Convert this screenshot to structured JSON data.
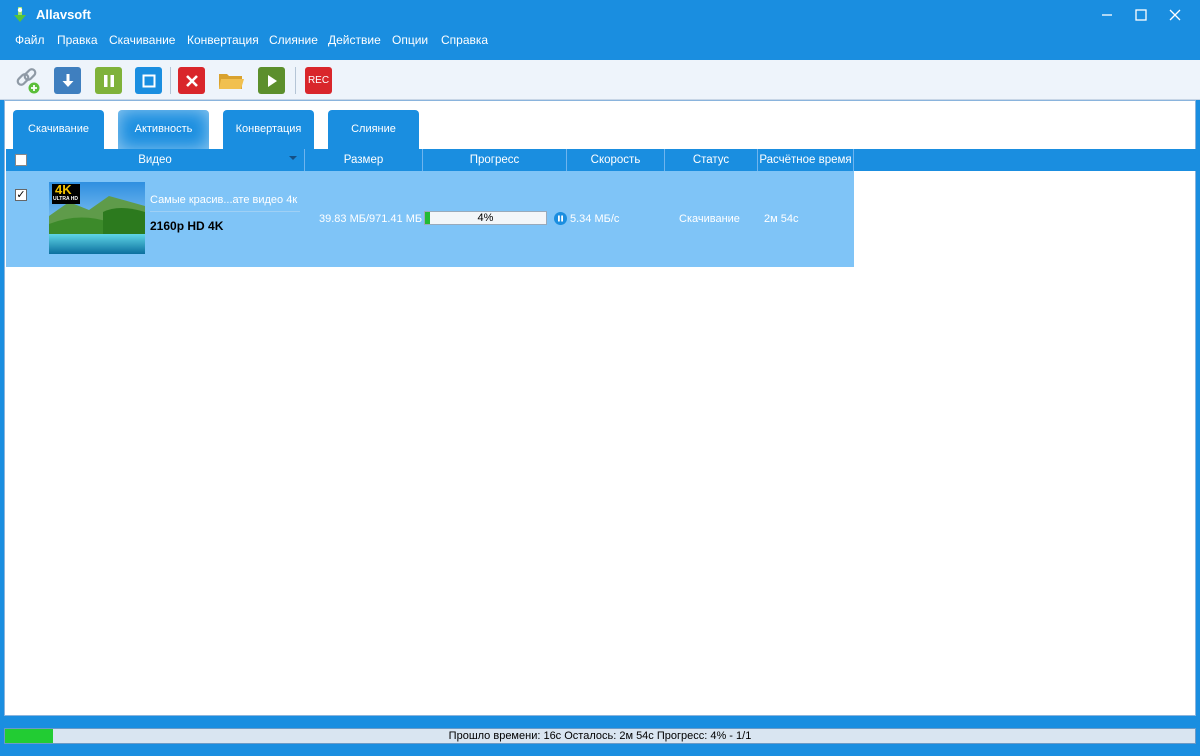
{
  "window": {
    "title": "Allavsoft"
  },
  "menu": [
    {
      "label": "Файл"
    },
    {
      "label": "Правка"
    },
    {
      "label": "Скачивание"
    },
    {
      "label": "Конвертация"
    },
    {
      "label": "Слияние"
    },
    {
      "label": "Действие"
    },
    {
      "label": "Опции"
    },
    {
      "label": "Справка"
    }
  ],
  "toolbar": {
    "buttons": [
      {
        "name": "add-link",
        "icon": "link-add-icon",
        "color": "#8f9aa6"
      },
      {
        "name": "download",
        "icon": "download-icon",
        "color": "#3f7fbf"
      },
      {
        "name": "pause",
        "icon": "pause-icon",
        "color": "#7fb23a"
      },
      {
        "name": "stop",
        "icon": "stop-icon",
        "color": "#1a8ee0"
      },
      {
        "name": "delete",
        "icon": "close-icon",
        "color": "#d9262b"
      },
      {
        "name": "open-folder",
        "icon": "folder-icon",
        "color": "#e8b13d"
      },
      {
        "name": "play",
        "icon": "play-icon",
        "color": "#5c8f2c"
      },
      {
        "name": "record",
        "icon": "rec-icon",
        "color": "#d9262b"
      }
    ],
    "rec_label": "REC"
  },
  "tabs": [
    {
      "label": "Скачивание",
      "active": false
    },
    {
      "label": "Активность",
      "active": true
    },
    {
      "label": "Конвертация",
      "active": false
    },
    {
      "label": "Слияние",
      "active": false
    }
  ],
  "table": {
    "columns": [
      "Видео",
      "Размер",
      "Прогресс",
      "Скорость",
      "Статус",
      "Расчётное время"
    ],
    "rows": [
      {
        "checked": true,
        "checkmark": "✓",
        "thumb_badge": "4K",
        "thumb_sub": "ULTRA HD",
        "title": "Самые красив...ате видео 4к",
        "quality": "2160p HD 4K",
        "size": "39.83 МБ/971.41 МБ",
        "progress_percent": 4,
        "progress_label": "4%",
        "speed": "5.34 МБ/с",
        "status": "Скачивание",
        "eta": "2м 54с"
      }
    ]
  },
  "statusbar": {
    "text": "Прошло времени: 16с Осталось: 2м 54с Прогресс: 4% - 1/1",
    "progress_percent": 4
  },
  "colors": {
    "accent": "#1a8ee0",
    "row_selected": "#7fc4f7",
    "progress": "#22bb33"
  }
}
